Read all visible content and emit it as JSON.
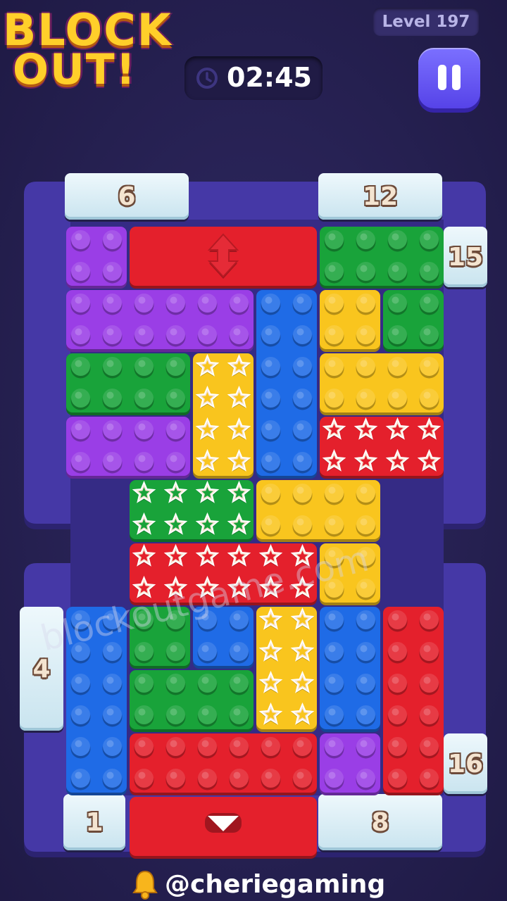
{
  "header": {
    "logo_line1": "BLOCK",
    "logo_line2": "OUT!",
    "level_label": "Level 197",
    "timer": "02:45"
  },
  "gates": [
    {
      "label": "6",
      "color": "#c9e4ef"
    },
    {
      "label": "12",
      "color": "#c9e4ef"
    },
    {
      "label": "15",
      "color": "#c9e4ef"
    },
    {
      "label": "4",
      "color": "#c9e4ef"
    },
    {
      "label": "16",
      "color": "#c9e4ef"
    },
    {
      "label": "1",
      "color": "#c9e4ef"
    },
    {
      "label": "8",
      "color": "#c9e4ef"
    }
  ],
  "pieces": [
    {
      "color": "purple",
      "studs": "dot"
    },
    {
      "color": "red",
      "studs": "arrow-vertical"
    },
    {
      "color": "green",
      "studs": "dot"
    },
    {
      "color": "blue",
      "studs": "dot"
    },
    {
      "color": "yellow",
      "studs": "dot"
    },
    {
      "color": "green",
      "studs": "dot"
    },
    {
      "color": "yellow",
      "studs": "star"
    },
    {
      "color": "purple",
      "studs": "dot"
    },
    {
      "color": "red",
      "studs": "star"
    },
    {
      "color": "green",
      "studs": "star"
    },
    {
      "color": "yellow",
      "studs": "dot"
    },
    {
      "color": "red",
      "studs": "star"
    },
    {
      "color": "blue",
      "studs": "dot"
    },
    {
      "color": "green",
      "studs": "dot"
    },
    {
      "color": "blue",
      "studs": "dot"
    },
    {
      "color": "yellow",
      "studs": "star"
    },
    {
      "color": "blue",
      "studs": "dot"
    },
    {
      "color": "red",
      "studs": "dot"
    },
    {
      "color": "red",
      "studs": "dot"
    },
    {
      "color": "purple",
      "studs": "dot"
    },
    {
      "color": "red",
      "studs": "arrow-down"
    }
  ],
  "palette": {
    "purple": "#9a3ee6",
    "red": "#e4202c",
    "green": "#19a33a",
    "blue": "#1f6be6",
    "yellow": "#f9c51e",
    "board": "#4538a6",
    "board_edge": "#2c2370"
  },
  "watermark": "blockoutgame.com",
  "credit": "@cheriegaming"
}
